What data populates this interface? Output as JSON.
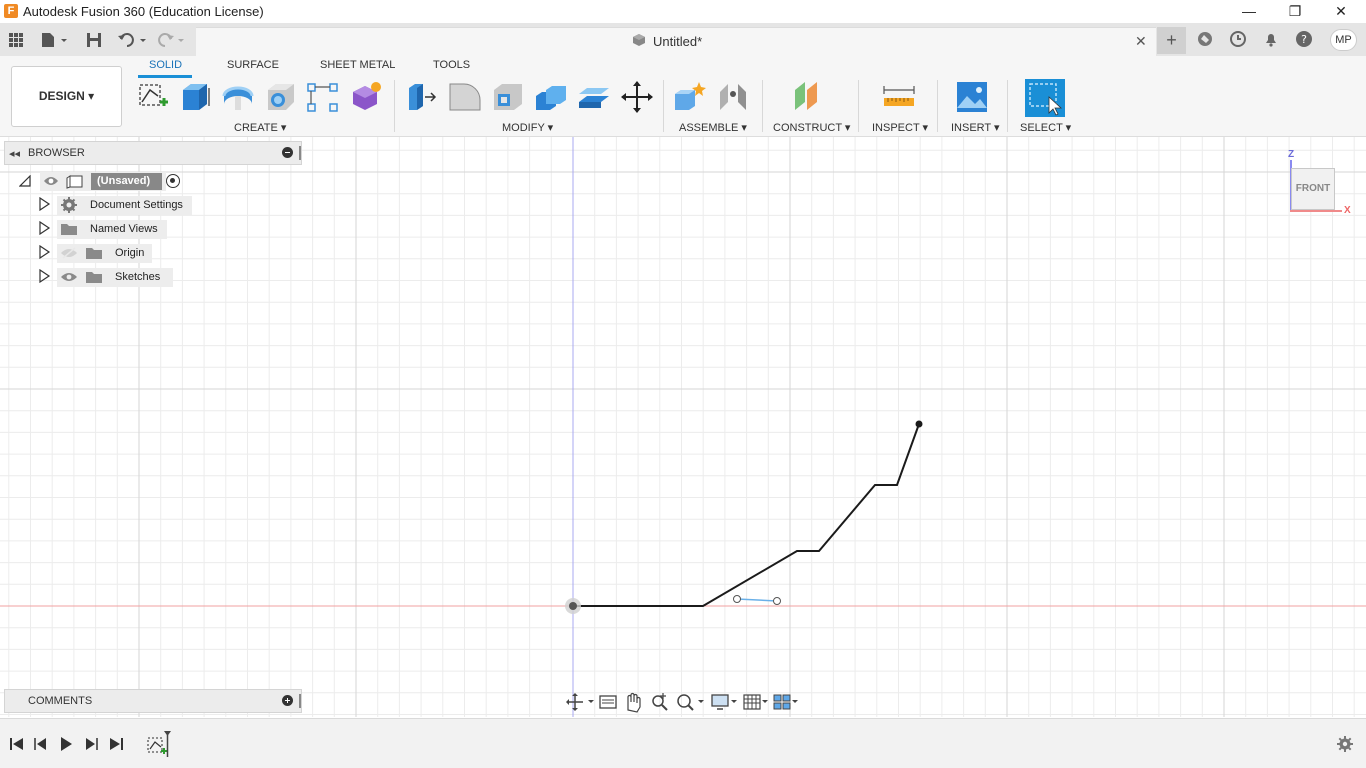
{
  "window": {
    "title": "Autodesk Fusion 360 (Education License)",
    "logo_letter": "F",
    "minimize": "—",
    "restore": "❐",
    "close": "✕"
  },
  "quick_access": {
    "doc_title": "Untitled*",
    "doc_close": "✕",
    "new_tab": "+",
    "avatar": "MP"
  },
  "toolbar": {
    "workspace": "DESIGN ▾",
    "tabs": [
      "SOLID",
      "SURFACE",
      "SHEET METAL",
      "TOOLS"
    ],
    "groups": {
      "create": "CREATE ▾",
      "modify": "MODIFY ▾",
      "assemble": "ASSEMBLE ▾",
      "construct": "CONSTRUCT ▾",
      "inspect": "INSPECT ▾",
      "insert": "INSERT ▾",
      "select": "SELECT ▾"
    }
  },
  "browser": {
    "title": "BROWSER",
    "root": "(Unsaved)",
    "items": [
      {
        "label": "Document Settings",
        "icon": "gear-icon"
      },
      {
        "label": "Named Views",
        "icon": "folder-icon"
      },
      {
        "label": "Origin",
        "icon": "folder-icon"
      },
      {
        "label": "Sketches",
        "icon": "folder-icon"
      }
    ]
  },
  "comments": {
    "title": "COMMENTS"
  },
  "viewcube": {
    "face": "FRONT",
    "axis_z": "Z",
    "axis_x": "X"
  },
  "colors": {
    "accent": "#1a8fd6",
    "x_axis": "#f08a8a",
    "z_axis": "#8a8af0",
    "sketch_line": "#1b1b1b"
  }
}
